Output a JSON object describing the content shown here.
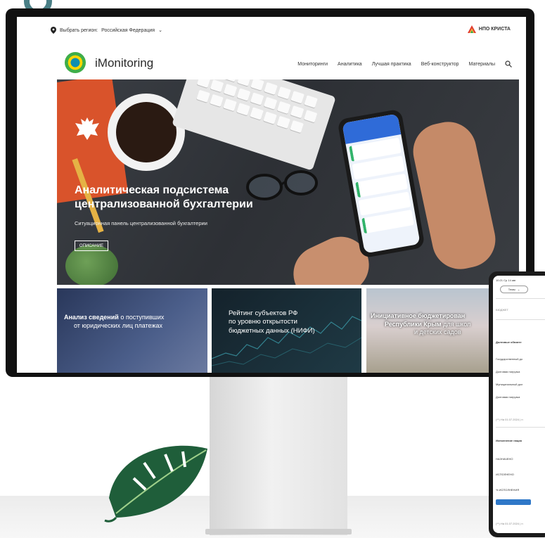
{
  "topbar": {
    "region_label": "Выбрать регион:",
    "region_value": "Российская Федерация",
    "brand": "НПО КРИСТА"
  },
  "header": {
    "logo_text": "iMonitoring",
    "nav": [
      "Мониторинги",
      "Аналитика",
      "Лучшая практика",
      "Веб-конструктор",
      "Материалы"
    ]
  },
  "hero": {
    "title_line1": "Аналитическая подсистема",
    "title_line2": "централизованной бухгалтерии",
    "subtitle": "Ситуационная панель централизованной бухгалтерии",
    "button": "ОПИСАНИЕ"
  },
  "cards": [
    {
      "line1_bold": "Анализ сведений",
      "line1_rest": " о поступивших",
      "line2": "от юридических лиц платежах"
    },
    {
      "line1": "Рейтинг субъектов РФ",
      "line2": "по уровню открытости",
      "line3": "бюджетных данных (НИФИ)"
    },
    {
      "line1": "Инициативное бюджетирован",
      "line2_bold": "Республики Крым",
      "line2_rest": " для школ",
      "line3": "и детских садов"
    }
  ],
  "tablet": {
    "status": "10:21  Ср 14 авг",
    "pill": "Темы",
    "section": "БЮДЖЕТ",
    "block1_title": "Долговые обязате",
    "rows1": [
      "Государственный до",
      "Долговая нагрузка",
      "Муниципальный дол",
      "Долговая нагрузка"
    ],
    "note1": "(**) На 01.07.2024 | н",
    "block2_title": "Исполнение нацио",
    "rows2": [
      "НАЗНАЧЕНО",
      "ИСПОЛНЕНО",
      "% ИСПОЛНЕНИЯ"
    ],
    "note2": "(**) На 01.07.2024 | н"
  },
  "colors": {
    "accent_teal": "#4a7f86",
    "brand_red": "#e03a2f",
    "link_blue": "#2f78c8"
  }
}
